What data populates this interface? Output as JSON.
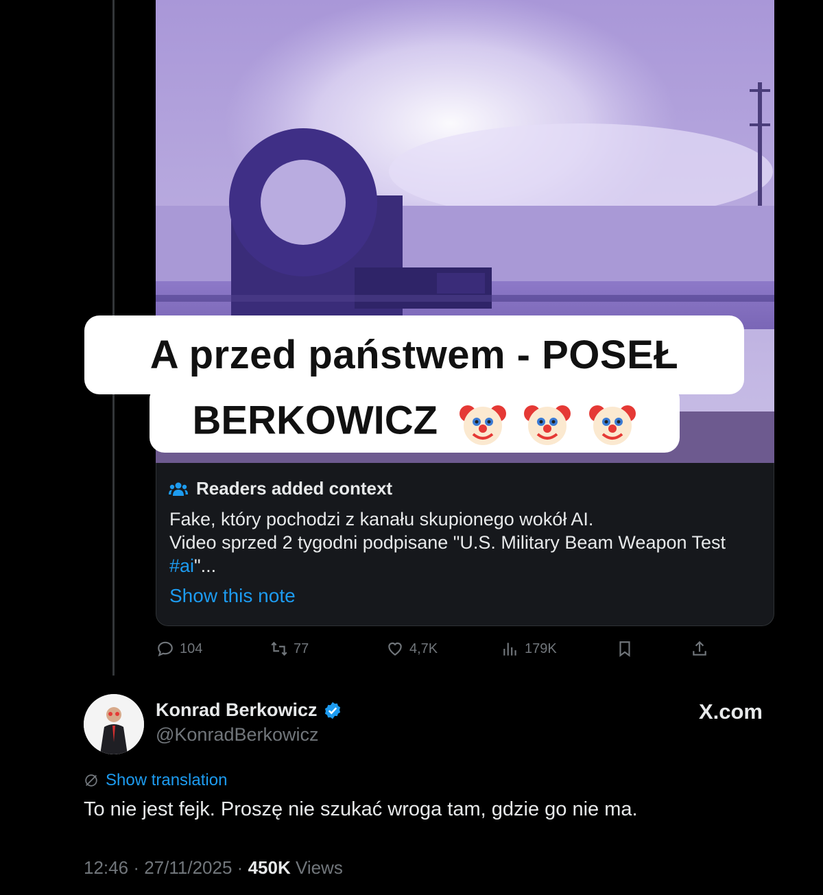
{
  "media": {
    "caption_line1": "A przed państwem - POSEŁ",
    "caption_line2": "BERKOWICZ",
    "caption_emoji": [
      "clown-emoji",
      "clown-emoji",
      "clown-emoji"
    ],
    "mute_icon": "speaker-muted-icon"
  },
  "note": {
    "header_icon": "people-icon",
    "header": "Readers added context",
    "body_line1": "Fake, który pochodzi z kanału skupionego wokół AI.",
    "body_line2": "Video sprzed 2 tygodni podpisane \"U.S. Military Beam Weapon Test",
    "body_hashtag": "#ai",
    "body_tail": "\"...",
    "link": "Show this note",
    "link_color": "#1d9bf0"
  },
  "actions": {
    "replies": "104",
    "reposts": "77",
    "likes": "4,7K",
    "views": "179K"
  },
  "reply": {
    "name": "Konrad Berkowicz",
    "handle": "@KonradBerkowicz",
    "brand": "X.com",
    "translate": "Show translation",
    "text": "To nie jest fejk. Proszę nie szukać wroga tam, gdzie go nie ma.",
    "time": "12:46",
    "date": "27/11/2025",
    "views_count": "450K",
    "views_label": "Views",
    "verified_color": "#1d9bf0"
  },
  "colors": {
    "background": "#000000",
    "note_bg": "#16181c",
    "muted": "#71767b",
    "accent": "#1d9bf0"
  }
}
